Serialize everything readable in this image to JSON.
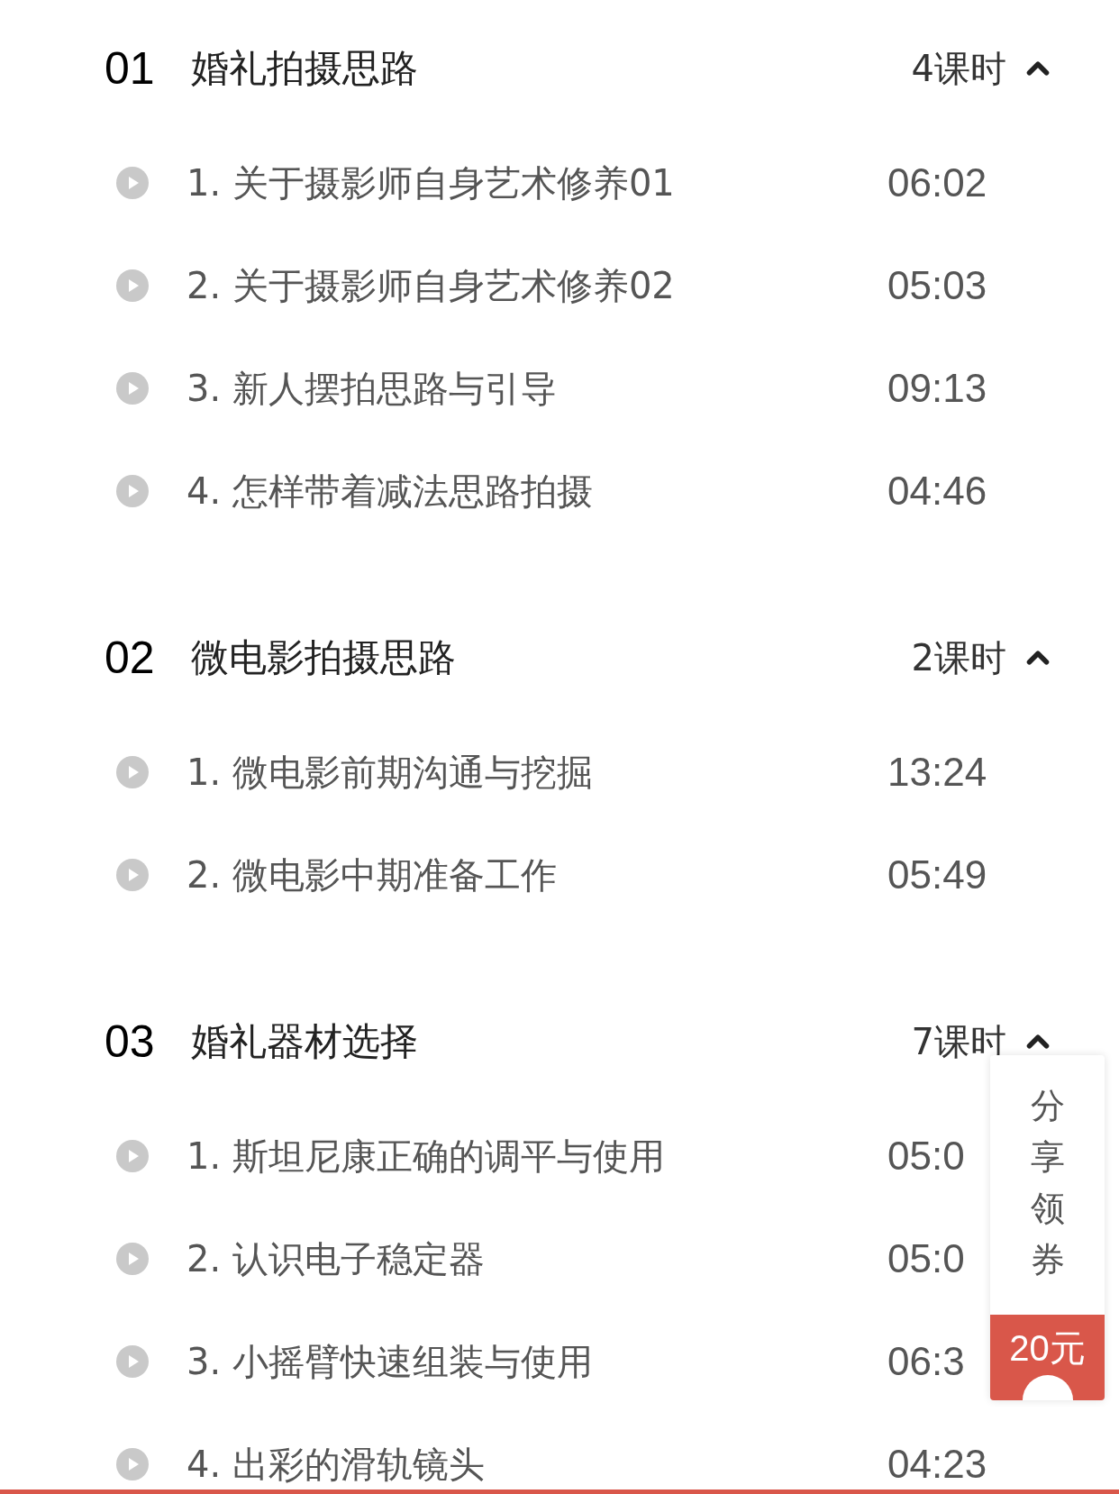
{
  "sections": [
    {
      "number": "01",
      "title": "婚礼拍摄思路",
      "lesson_count": "4课时",
      "expanded": true,
      "lessons": [
        {
          "title": "1. 关于摄影师自身艺术修养01",
          "duration": "06:02"
        },
        {
          "title": "2. 关于摄影师自身艺术修养02",
          "duration": "05:03"
        },
        {
          "title": "3. 新人摆拍思路与引导",
          "duration": "09:13"
        },
        {
          "title": "4. 怎样带着减法思路拍摄",
          "duration": "04:46"
        }
      ]
    },
    {
      "number": "02",
      "title": "微电影拍摄思路",
      "lesson_count": "2课时",
      "expanded": true,
      "lessons": [
        {
          "title": "1. 微电影前期沟通与挖掘",
          "duration": "13:24"
        },
        {
          "title": "2. 微电影中期准备工作",
          "duration": "05:49"
        }
      ]
    },
    {
      "number": "03",
      "title": "婚礼器材选择",
      "lesson_count": "7课时",
      "expanded": true,
      "lessons": [
        {
          "title": "1. 斯坦尼康正确的调平与使用",
          "duration": "05:0"
        },
        {
          "title": "2. 认识电子稳定器",
          "duration": "05:0"
        },
        {
          "title": "3. 小摇臂快速组装与使用",
          "duration": "06:3"
        },
        {
          "title": "4. 出彩的滑轨镜头",
          "duration": "04:23"
        }
      ]
    }
  ],
  "coupon": {
    "label": "分享领券",
    "amount": "20元"
  }
}
